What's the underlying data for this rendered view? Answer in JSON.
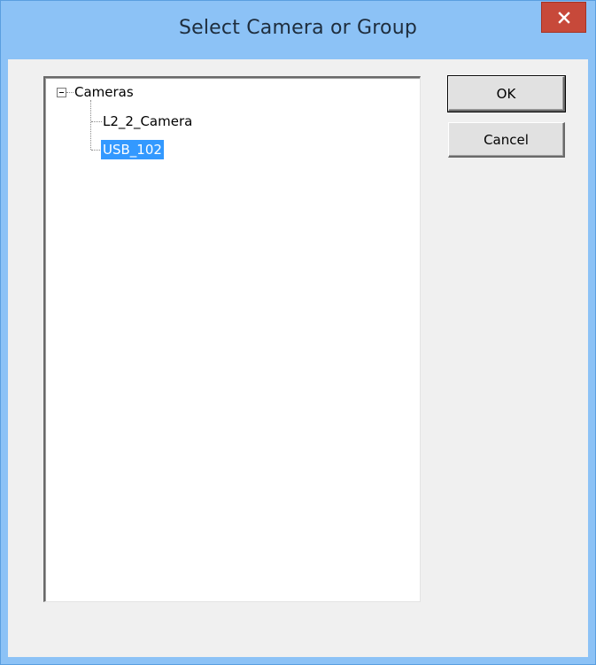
{
  "window": {
    "title": "Select Camera or Group",
    "close_icon": "close-icon",
    "accent_color": "#8cc2f6",
    "close_color": "#c7493a"
  },
  "tree": {
    "root": {
      "label": "Cameras",
      "expanded": true,
      "expander_icon": "collapse-minus-icon"
    },
    "children": [
      {
        "label": "L2_2_Camera",
        "selected": false
      },
      {
        "label": "USB_102",
        "selected": true
      }
    ],
    "selection_color": "#3399ff"
  },
  "buttons": {
    "ok_label": "OK",
    "cancel_label": "Cancel"
  }
}
